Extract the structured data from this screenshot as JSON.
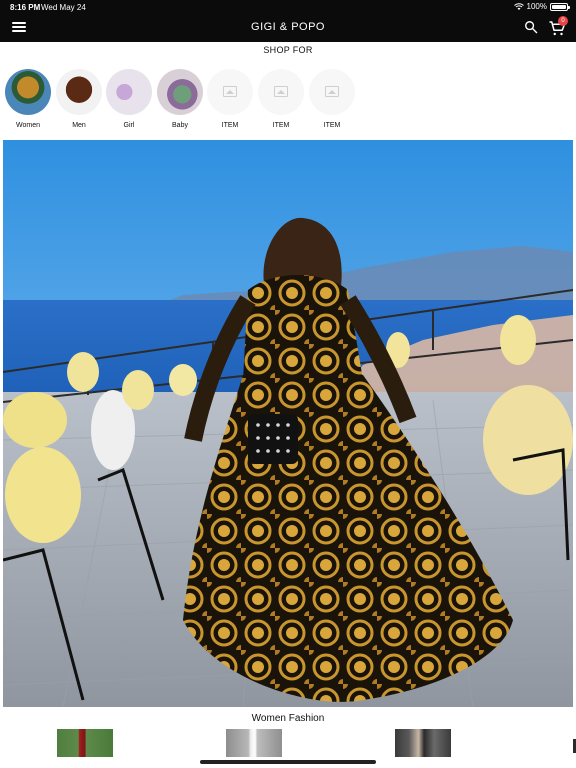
{
  "status_bar": {
    "time": "8:16 PM",
    "date": "Wed May 24",
    "battery": "100%"
  },
  "header": {
    "title": "GIGI & POPO",
    "cart_count": "0"
  },
  "shop_for": {
    "heading": "SHOP FOR",
    "categories": [
      {
        "label": "Women"
      },
      {
        "label": "Men"
      },
      {
        "label": "Girl"
      },
      {
        "label": "Baby"
      },
      {
        "label": "ITEM"
      },
      {
        "label": "ITEM"
      },
      {
        "label": "ITEM"
      }
    ]
  },
  "section": {
    "title": "Women Fashion"
  },
  "colors": {
    "header_bg": "#0b0b0b",
    "badge": "#e64646"
  }
}
